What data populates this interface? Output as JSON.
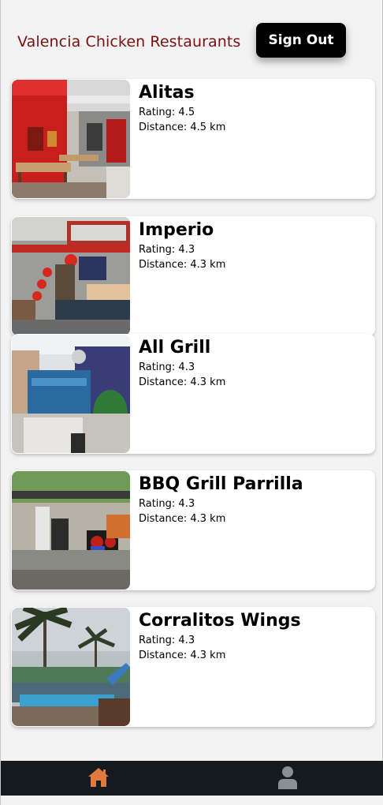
{
  "header": {
    "title": "Valencia Chicken Restaurants",
    "sign_out_label": "Sign Out"
  },
  "restaurants": [
    {
      "name": "Alitas",
      "rating": "Rating: 4.5",
      "distance": "Distance: 4.5 km"
    },
    {
      "name": "Imperio",
      "rating": "Rating: 4.3",
      "distance": "Distance: 4.3 km"
    },
    {
      "name": "All Grill",
      "rating": "Rating: 4.3",
      "distance": "Distance: 4.3 km"
    },
    {
      "name": "BBQ Grill Parrilla",
      "rating": "Rating: 4.3",
      "distance": "Distance: 4.3 km"
    },
    {
      "name": "Corralitos Wings",
      "rating": "Rating: 4.3",
      "distance": "Distance: 4.3 km"
    }
  ],
  "bottom_nav": {
    "items": [
      {
        "icon": "home-icon",
        "active": true
      },
      {
        "icon": "user-icon",
        "active": false
      }
    ],
    "active_color": "#e07a3c",
    "inactive_color": "#8a8f95"
  },
  "colors": {
    "title": "#7a1010",
    "button_bg": "#000000",
    "nav_bg": "#151a20"
  }
}
